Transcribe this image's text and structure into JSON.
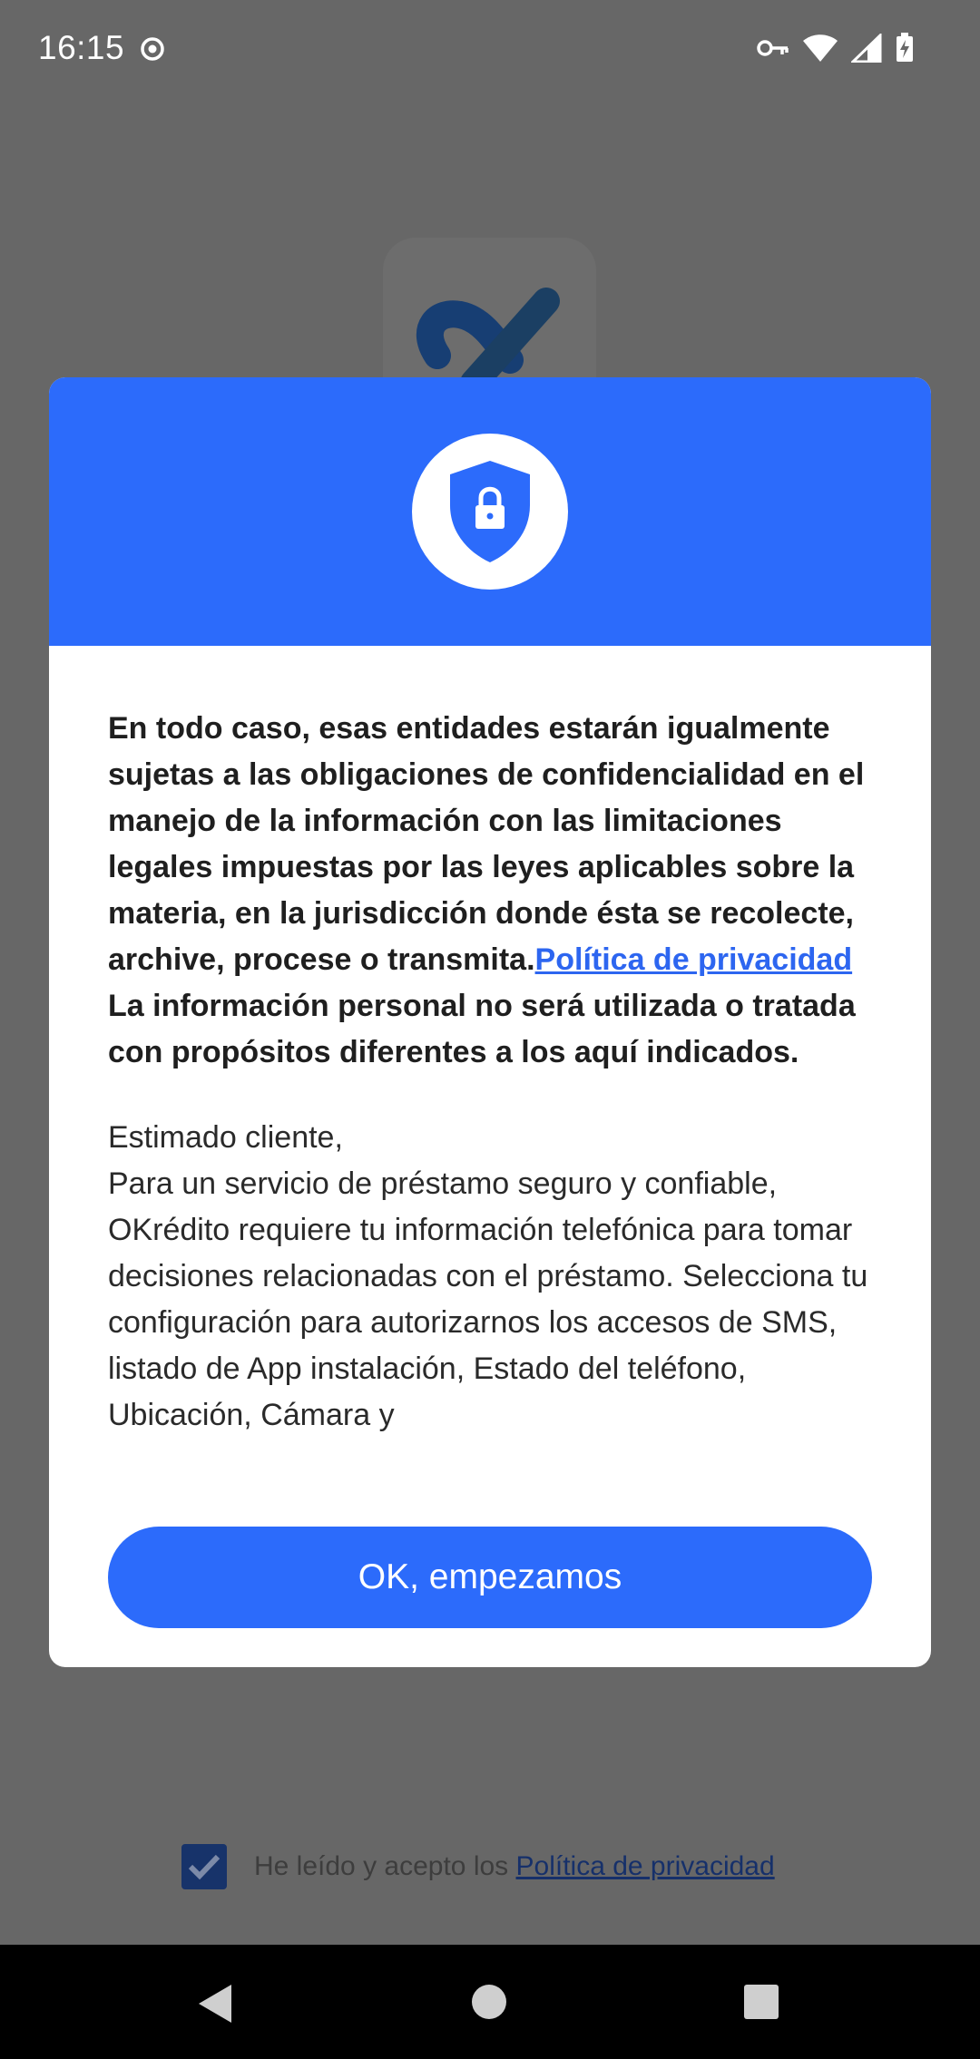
{
  "status_bar": {
    "time": "16:15",
    "icons": [
      "record-dot-icon",
      "vpn-key-icon",
      "wifi-icon",
      "cell-signal-icon",
      "battery-charging-icon"
    ]
  },
  "dialog": {
    "header_icon": "shield-lock-icon",
    "paragraph1_text": "En todo caso, esas entidades estarán igualmente sujetas a las obligaciones de confidencialidad en el manejo de la información con las limitaciones legales impuestas por las leyes aplicables sobre la materia, en la jurisdicción donde ésta se recolecte, archive, procese o transmita.",
    "paragraph1_link": "Política de privacidad",
    "paragraph2_text": "La información personal no será utilizada o tratada con propósitos diferentes a los aquí indicados.",
    "paragraph3_line1": "Estimado cliente,",
    "paragraph3_text": "Para un servicio de préstamo seguro y confiable, OKrédito requiere tu información telefónica para tomar decisiones relacionadas con el préstamo. Selecciona tu configuración para autorizarnos los accesos de SMS, listado de App instalación, Estado del teléfono, Ubicación, Cámara y",
    "button_label": "OK, empezamos"
  },
  "background": {
    "consent_checked": true,
    "consent_text": "He leído y acepto los ",
    "consent_link": "Política de privacidad"
  },
  "colors": {
    "accent": "#2c6bfb",
    "link": "#2d66f0",
    "scrim": "#676767"
  }
}
